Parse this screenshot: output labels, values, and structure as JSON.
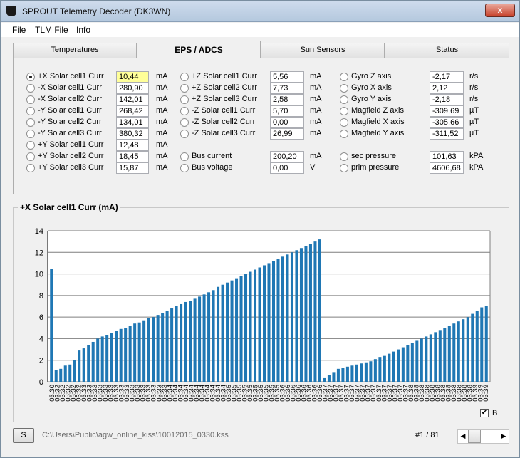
{
  "window": {
    "title": "SPROUT Telemetry Decoder (DK3WN)",
    "close_label": "x"
  },
  "menu": [
    "File",
    "TLM File",
    "Info"
  ],
  "tabs": [
    {
      "label": "Temperatures",
      "active": false
    },
    {
      "label": "EPS / ADCS",
      "active": true
    },
    {
      "label": "Sun Sensors",
      "active": false
    },
    {
      "label": "Status",
      "active": false
    }
  ],
  "col1": [
    {
      "label": "+X Solar cell1 Curr",
      "value": "10,44",
      "unit": "mA",
      "selected": true
    },
    {
      "label": "-X Solar cell1 Curr",
      "value": "280,90",
      "unit": "mA"
    },
    {
      "label": "-X Solar cell2 Curr",
      "value": "142,01",
      "unit": "mA"
    },
    {
      "label": "-Y Solar cell1 Curr",
      "value": "268,42",
      "unit": "mA"
    },
    {
      "label": "-Y Solar cell2 Curr",
      "value": "134,01",
      "unit": "mA"
    },
    {
      "label": "-Y Solar cell3 Curr",
      "value": "380,32",
      "unit": "mA"
    },
    {
      "label": "+Y Solar cell1 Curr",
      "value": "12,48",
      "unit": "mA"
    },
    {
      "label": "+Y Solar cell2 Curr",
      "value": "18,45",
      "unit": "mA"
    },
    {
      "label": "+Y Solar cell3 Curr",
      "value": "15,87",
      "unit": "mA"
    }
  ],
  "col2": [
    {
      "label": "+Z Solar cell1 Curr",
      "value": "5,56",
      "unit": "mA"
    },
    {
      "label": "+Z Solar cell2 Curr",
      "value": "7,73",
      "unit": "mA"
    },
    {
      "label": "+Z Solar cell3 Curr",
      "value": "2,58",
      "unit": "mA"
    },
    {
      "label": "-Z Solar cell1 Curr",
      "value": "5,70",
      "unit": "mA"
    },
    {
      "label": "-Z Solar cell2 Curr",
      "value": "0,00",
      "unit": "mA"
    },
    {
      "label": "-Z Solar cell3 Curr",
      "value": "26,99",
      "unit": "mA"
    },
    {
      "label": "Bus current",
      "value": "200,20",
      "unit": "mA"
    },
    {
      "label": "Bus voltage",
      "value": "0,00",
      "unit": "V"
    }
  ],
  "col3": [
    {
      "label": "Gyro Z axis",
      "value": "-2,17",
      "unit": "r/s"
    },
    {
      "label": "Gyro X axis",
      "value": "2,12",
      "unit": "r/s"
    },
    {
      "label": "Gyro Y axis",
      "value": "-2,18",
      "unit": "r/s"
    },
    {
      "label": "Magfield Z axis",
      "value": "-309,69",
      "unit": "µT"
    },
    {
      "label": "Magfield X axis",
      "value": "-305,66",
      "unit": "µT"
    },
    {
      "label": "Magfield Y axis",
      "value": "-311,52",
      "unit": "µT"
    },
    {
      "label": "sec pressure",
      "value": "101,63",
      "unit": "kPA"
    },
    {
      "label": "prim pressure",
      "value": "4606,68",
      "unit": "kPA"
    }
  ],
  "chart_group_title": "+X Solar cell1 Curr (mA)",
  "checkbox": {
    "label": "B",
    "checked": true
  },
  "status": {
    "button_label": "S",
    "file_path": "C:\\Users\\Public\\agw_online_kiss\\10012015_0330.kss",
    "pager": "#1 / 81"
  },
  "colors": {
    "bar": "#1f77b4",
    "grid": "#7f7f7f"
  },
  "chart_data": {
    "type": "bar",
    "ylim": [
      0,
      14
    ],
    "yticks": [
      0,
      2,
      4,
      6,
      8,
      10,
      12,
      14
    ],
    "grid": true,
    "x": [
      "03:30",
      "03:32",
      "03:32",
      "03:32",
      "03:32",
      "03:32",
      "03:33",
      "03:33",
      "03:33",
      "03:33",
      "03:33",
      "03:33",
      "03:33",
      "03:33",
      "03:33",
      "03:33",
      "03:33",
      "03:33",
      "03:33",
      "03:33",
      "03:33",
      "03:33",
      "03:34",
      "03:34",
      "03:34",
      "03:34",
      "03:34",
      "03:34",
      "03:34",
      "03:34",
      "03:34",
      "03:34",
      "03:34",
      "03:35",
      "03:35",
      "03:35",
      "03:35",
      "03:35",
      "03:35",
      "03:35",
      "03:35",
      "03:35",
      "03:35",
      "03:36",
      "03:36",
      "03:36",
      "03:36",
      "03:36",
      "03:36",
      "03:36",
      "03:36",
      "03:37",
      "03:37",
      "03:37",
      "03:37",
      "03:37",
      "03:37",
      "03:37",
      "03:37",
      "03:37",
      "03:37",
      "03:37",
      "03:37",
      "03:37",
      "03:37",
      "03:37",
      "03:37",
      "03:38",
      "03:38",
      "03:38",
      "03:38",
      "03:38",
      "03:38",
      "03:38",
      "03:38",
      "03:38",
      "03:38",
      "03:38",
      "03:38",
      "03:39",
      "03:39",
      "03:39"
    ],
    "values": [
      10.5,
      1.1,
      1.2,
      1.5,
      1.6,
      2.0,
      2.9,
      3.1,
      3.4,
      3.7,
      4.0,
      4.2,
      4.3,
      4.5,
      4.7,
      4.9,
      5.0,
      5.2,
      5.4,
      5.5,
      5.7,
      5.9,
      6.0,
      6.2,
      6.4,
      6.6,
      6.8,
      7.0,
      7.2,
      7.4,
      7.5,
      7.7,
      7.9,
      8.1,
      8.3,
      8.5,
      8.8,
      9.0,
      9.2,
      9.4,
      9.6,
      9.8,
      10.0,
      10.2,
      10.4,
      10.6,
      10.8,
      11.0,
      11.2,
      11.4,
      11.6,
      11.8,
      12.0,
      12.2,
      12.4,
      12.6,
      12.8,
      13.0,
      13.2,
      0.4,
      0.6,
      0.9,
      1.2,
      1.3,
      1.4,
      1.5,
      1.6,
      1.7,
      1.8,
      1.9,
      2.1,
      2.3,
      2.4,
      2.6,
      2.8,
      3.0,
      3.2,
      3.4,
      3.6,
      3.8,
      4.0,
      4.2,
      4.4,
      4.6,
      4.8,
      5.0,
      5.2,
      5.4,
      5.6,
      5.8,
      6.0,
      6.3,
      6.6,
      6.9,
      7.0
    ]
  }
}
